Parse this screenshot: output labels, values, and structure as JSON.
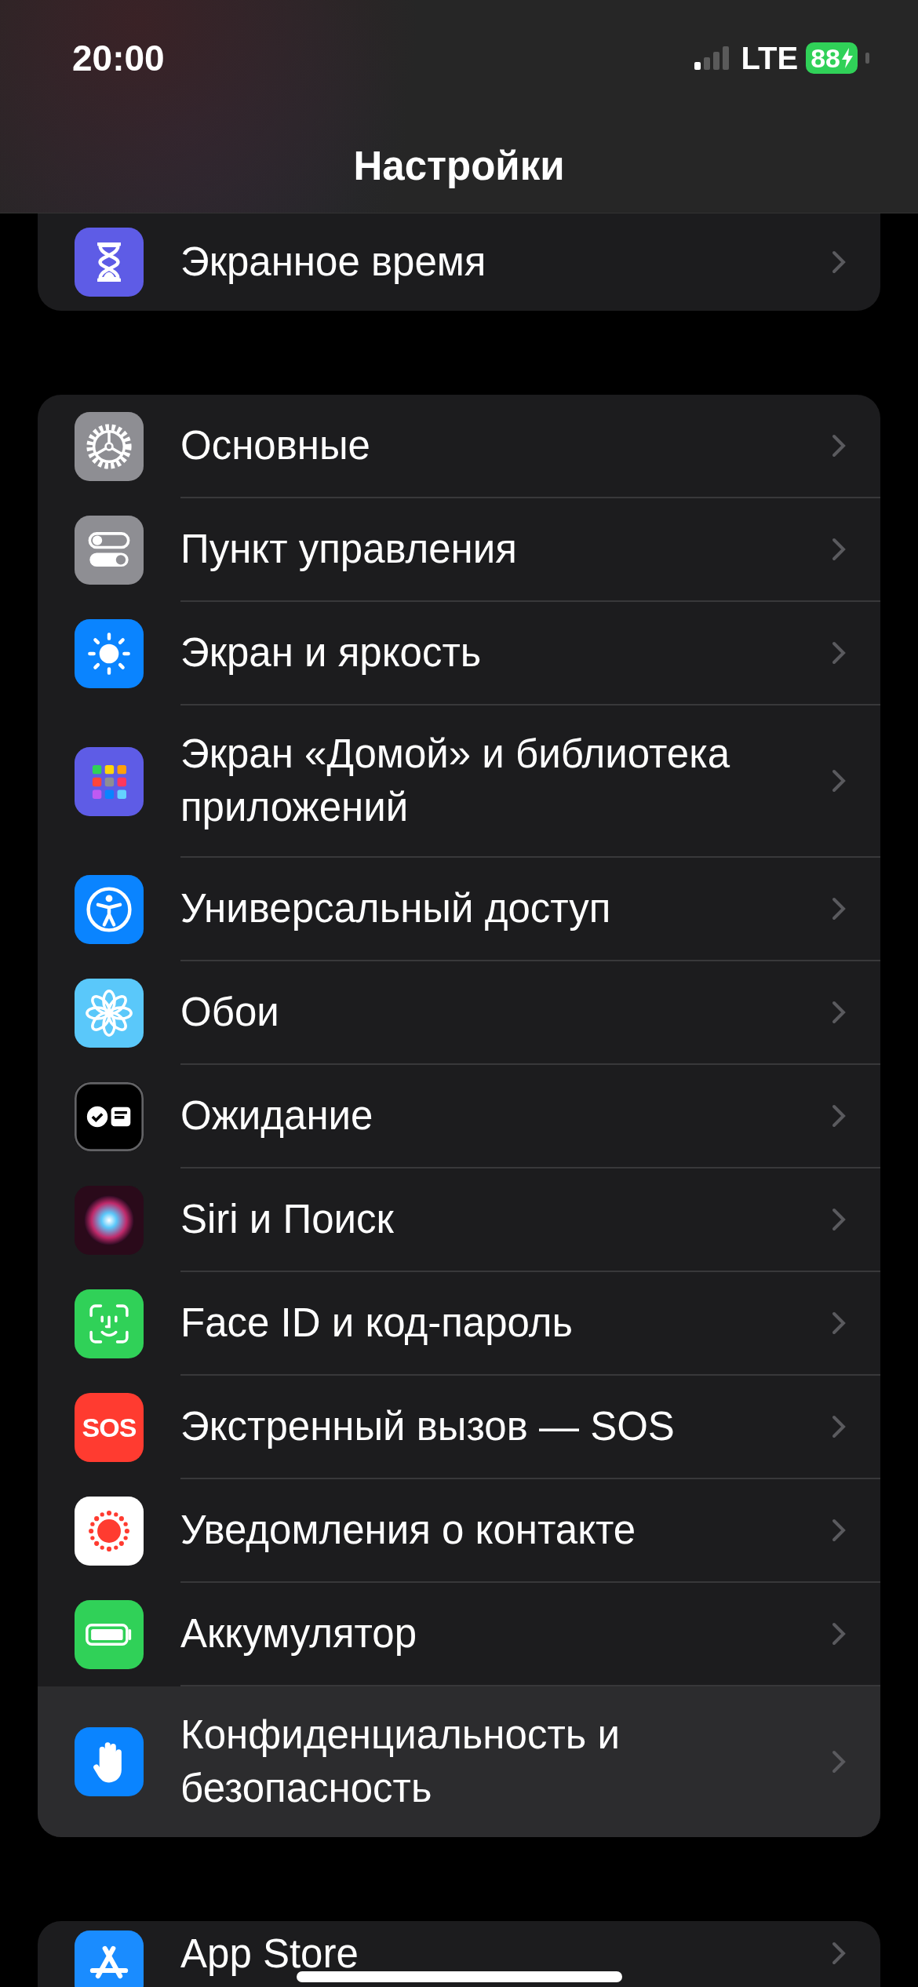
{
  "status_bar": {
    "time": "20:00",
    "network": "LTE",
    "battery": "88"
  },
  "title": "Настройки",
  "groups": [
    {
      "items": [
        {
          "label": "Экранное время",
          "selected": false
        }
      ]
    },
    {
      "items": [
        {
          "label": "Основные",
          "selected": false
        },
        {
          "label": "Пункт управления",
          "selected": false
        },
        {
          "label": "Экран и яркость",
          "selected": false
        },
        {
          "label": "Экран «Домой» и библиотека приложений",
          "selected": false
        },
        {
          "label": "Универсальный доступ",
          "selected": false
        },
        {
          "label": "Обои",
          "selected": false
        },
        {
          "label": "Ожидание",
          "selected": false
        },
        {
          "label": "Siri и Поиск",
          "selected": false
        },
        {
          "label": "Face ID и код-пароль",
          "selected": false
        },
        {
          "label": "Экстренный вызов — SOS",
          "selected": false,
          "icon_text": "SOS"
        },
        {
          "label": "Уведомления о контакте",
          "selected": false
        },
        {
          "label": "Аккумулятор",
          "selected": false
        },
        {
          "label": "Конфиденциальность и безопасность",
          "selected": true
        }
      ]
    },
    {
      "items": [
        {
          "label": "App Store",
          "selected": false
        }
      ]
    }
  ]
}
